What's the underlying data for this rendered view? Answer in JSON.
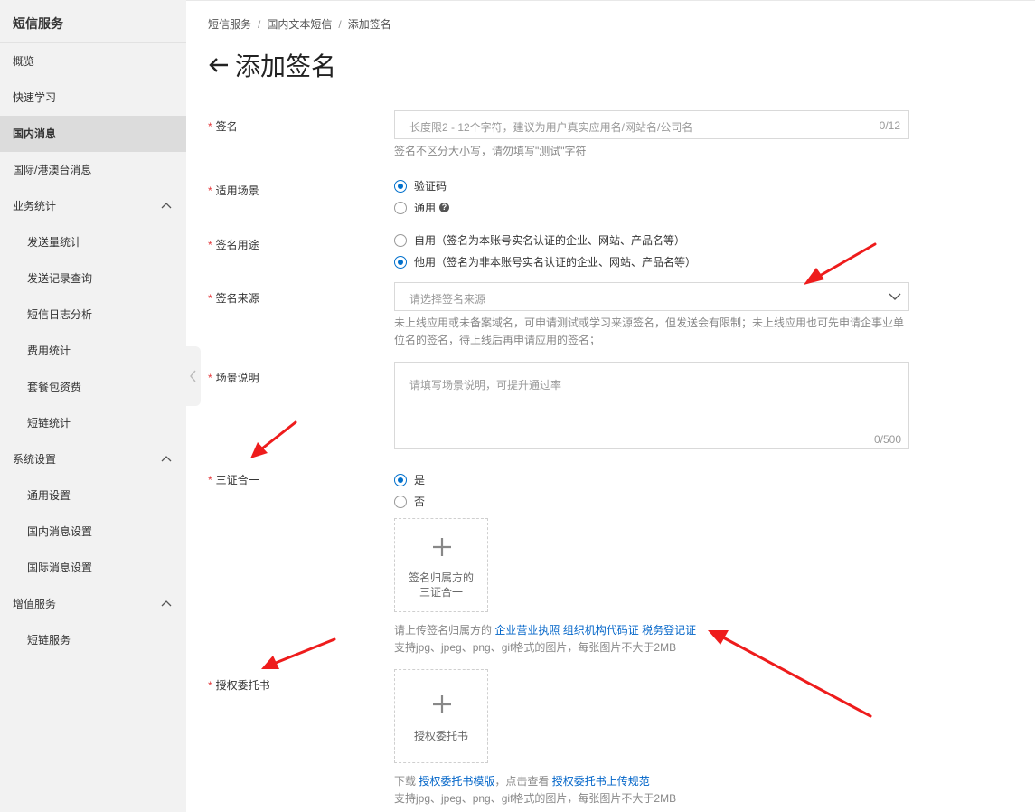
{
  "sidebar": {
    "title": "短信服务",
    "items": [
      {
        "label": "概览"
      },
      {
        "label": "快速学习"
      },
      {
        "label": "国内消息"
      },
      {
        "label": "国际/港澳台消息"
      },
      {
        "label": "业务统计"
      },
      {
        "label": "发送量统计"
      },
      {
        "label": "发送记录查询"
      },
      {
        "label": "短信日志分析"
      },
      {
        "label": "费用统计"
      },
      {
        "label": "套餐包资费"
      },
      {
        "label": "短链统计"
      },
      {
        "label": "系统设置"
      },
      {
        "label": "通用设置"
      },
      {
        "label": "国内消息设置"
      },
      {
        "label": "国际消息设置"
      },
      {
        "label": "增值服务"
      },
      {
        "label": "短链服务"
      }
    ]
  },
  "breadcrumb": [
    "短信服务",
    "国内文本短信",
    "添加签名"
  ],
  "breadcrumb_sep": "/",
  "page_title": "添加签名",
  "form": {
    "required_mark": "*",
    "signature": {
      "label": "签名",
      "placeholder": "长度限2 - 12个字符，建议为用户真实应用名/网站名/公司名",
      "counter": "0/12",
      "hint": "签名不区分大小写，请勿填写\"测试\"字符"
    },
    "scene": {
      "label": "适用场景",
      "options": [
        "验证码",
        "通用"
      ],
      "help_glyph": "?"
    },
    "usage": {
      "label": "签名用途",
      "options": [
        "自用（签名为本账号实名认证的企业、网站、产品名等）",
        "他用（签名为非本账号实名认证的企业、网站、产品名等）"
      ]
    },
    "source": {
      "label": "签名来源",
      "placeholder": "请选择签名来源",
      "hint_line1": "未上线应用或未备案域名，可申请测试或学习来源签名，但发送会有限制；未上线应用也可先申请企事业单",
      "hint_line2": "位名的签名，待上线后再申请应用的签名；"
    },
    "description": {
      "label": "场景说明",
      "placeholder": "请填写场景说明，可提升通过率",
      "counter": "0/500"
    },
    "three_in_one": {
      "label": "三证合一",
      "options": [
        "是",
        "否"
      ],
      "upload_line1": "签名归属方的",
      "upload_line2": "三证合一",
      "hint_prefix": "请上传签名归属方的",
      "links": [
        "企业营业执照",
        "组织机构代码证",
        "税务登记证"
      ],
      "formats": "支持jpg、jpeg、png、gif格式的图片，每张图片不大于2MB"
    },
    "authorization": {
      "label": "授权委托书",
      "upload_text": "授权委托书",
      "hint_download": "下载",
      "link_template": "授权委托书模版",
      "hint_mid": "，点击查看",
      "link_rules": "授权委托书上传规范",
      "formats": "支持jpg、jpeg、png、gif格式的图片，每张图片不大于2MB"
    }
  },
  "colors": {
    "accent": "#ff6a00",
    "link": "#0064c8",
    "radio": "#0070cc",
    "required": "#e4393c",
    "annotation_arrow": "#ee1c1c"
  }
}
